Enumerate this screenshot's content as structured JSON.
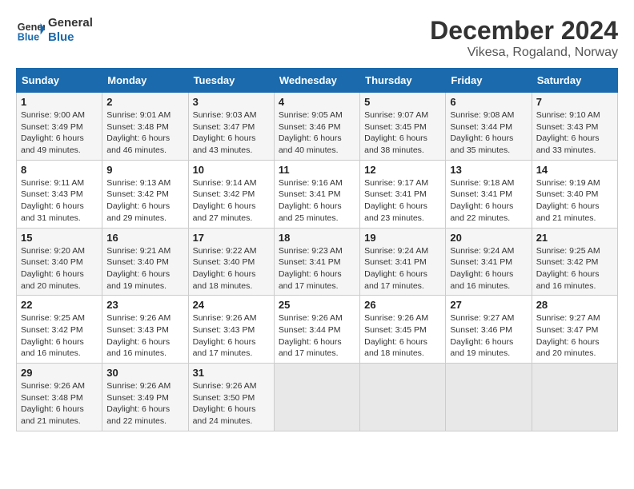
{
  "logo": {
    "text_general": "General",
    "text_blue": "Blue"
  },
  "title": "December 2024",
  "subtitle": "Vikesa, Rogaland, Norway",
  "days_of_week": [
    "Sunday",
    "Monday",
    "Tuesday",
    "Wednesday",
    "Thursday",
    "Friday",
    "Saturday"
  ],
  "weeks": [
    [
      {
        "day": "1",
        "sunrise": "9:00 AM",
        "sunset": "3:49 PM",
        "daylight": "6 hours and 49 minutes."
      },
      {
        "day": "2",
        "sunrise": "9:01 AM",
        "sunset": "3:48 PM",
        "daylight": "6 hours and 46 minutes."
      },
      {
        "day": "3",
        "sunrise": "9:03 AM",
        "sunset": "3:47 PM",
        "daylight": "6 hours and 43 minutes."
      },
      {
        "day": "4",
        "sunrise": "9:05 AM",
        "sunset": "3:46 PM",
        "daylight": "6 hours and 40 minutes."
      },
      {
        "day": "5",
        "sunrise": "9:07 AM",
        "sunset": "3:45 PM",
        "daylight": "6 hours and 38 minutes."
      },
      {
        "day": "6",
        "sunrise": "9:08 AM",
        "sunset": "3:44 PM",
        "daylight": "6 hours and 35 minutes."
      },
      {
        "day": "7",
        "sunrise": "9:10 AM",
        "sunset": "3:43 PM",
        "daylight": "6 hours and 33 minutes."
      }
    ],
    [
      {
        "day": "8",
        "sunrise": "9:11 AM",
        "sunset": "3:43 PM",
        "daylight": "6 hours and 31 minutes."
      },
      {
        "day": "9",
        "sunrise": "9:13 AM",
        "sunset": "3:42 PM",
        "daylight": "6 hours and 29 minutes."
      },
      {
        "day": "10",
        "sunrise": "9:14 AM",
        "sunset": "3:42 PM",
        "daylight": "6 hours and 27 minutes."
      },
      {
        "day": "11",
        "sunrise": "9:16 AM",
        "sunset": "3:41 PM",
        "daylight": "6 hours and 25 minutes."
      },
      {
        "day": "12",
        "sunrise": "9:17 AM",
        "sunset": "3:41 PM",
        "daylight": "6 hours and 23 minutes."
      },
      {
        "day": "13",
        "sunrise": "9:18 AM",
        "sunset": "3:41 PM",
        "daylight": "6 hours and 22 minutes."
      },
      {
        "day": "14",
        "sunrise": "9:19 AM",
        "sunset": "3:40 PM",
        "daylight": "6 hours and 21 minutes."
      }
    ],
    [
      {
        "day": "15",
        "sunrise": "9:20 AM",
        "sunset": "3:40 PM",
        "daylight": "6 hours and 20 minutes."
      },
      {
        "day": "16",
        "sunrise": "9:21 AM",
        "sunset": "3:40 PM",
        "daylight": "6 hours and 19 minutes."
      },
      {
        "day": "17",
        "sunrise": "9:22 AM",
        "sunset": "3:40 PM",
        "daylight": "6 hours and 18 minutes."
      },
      {
        "day": "18",
        "sunrise": "9:23 AM",
        "sunset": "3:41 PM",
        "daylight": "6 hours and 17 minutes."
      },
      {
        "day": "19",
        "sunrise": "9:24 AM",
        "sunset": "3:41 PM",
        "daylight": "6 hours and 17 minutes."
      },
      {
        "day": "20",
        "sunrise": "9:24 AM",
        "sunset": "3:41 PM",
        "daylight": "6 hours and 16 minutes."
      },
      {
        "day": "21",
        "sunrise": "9:25 AM",
        "sunset": "3:42 PM",
        "daylight": "6 hours and 16 minutes."
      }
    ],
    [
      {
        "day": "22",
        "sunrise": "9:25 AM",
        "sunset": "3:42 PM",
        "daylight": "6 hours and 16 minutes."
      },
      {
        "day": "23",
        "sunrise": "9:26 AM",
        "sunset": "3:43 PM",
        "daylight": "6 hours and 16 minutes."
      },
      {
        "day": "24",
        "sunrise": "9:26 AM",
        "sunset": "3:43 PM",
        "daylight": "6 hours and 17 minutes."
      },
      {
        "day": "25",
        "sunrise": "9:26 AM",
        "sunset": "3:44 PM",
        "daylight": "6 hours and 17 minutes."
      },
      {
        "day": "26",
        "sunrise": "9:26 AM",
        "sunset": "3:45 PM",
        "daylight": "6 hours and 18 minutes."
      },
      {
        "day": "27",
        "sunrise": "9:27 AM",
        "sunset": "3:46 PM",
        "daylight": "6 hours and 19 minutes."
      },
      {
        "day": "28",
        "sunrise": "9:27 AM",
        "sunset": "3:47 PM",
        "daylight": "6 hours and 20 minutes."
      }
    ],
    [
      {
        "day": "29",
        "sunrise": "9:26 AM",
        "sunset": "3:48 PM",
        "daylight": "6 hours and 21 minutes."
      },
      {
        "day": "30",
        "sunrise": "9:26 AM",
        "sunset": "3:49 PM",
        "daylight": "6 hours and 22 minutes."
      },
      {
        "day": "31",
        "sunrise": "9:26 AM",
        "sunset": "3:50 PM",
        "daylight": "6 hours and 24 minutes."
      },
      null,
      null,
      null,
      null
    ]
  ]
}
